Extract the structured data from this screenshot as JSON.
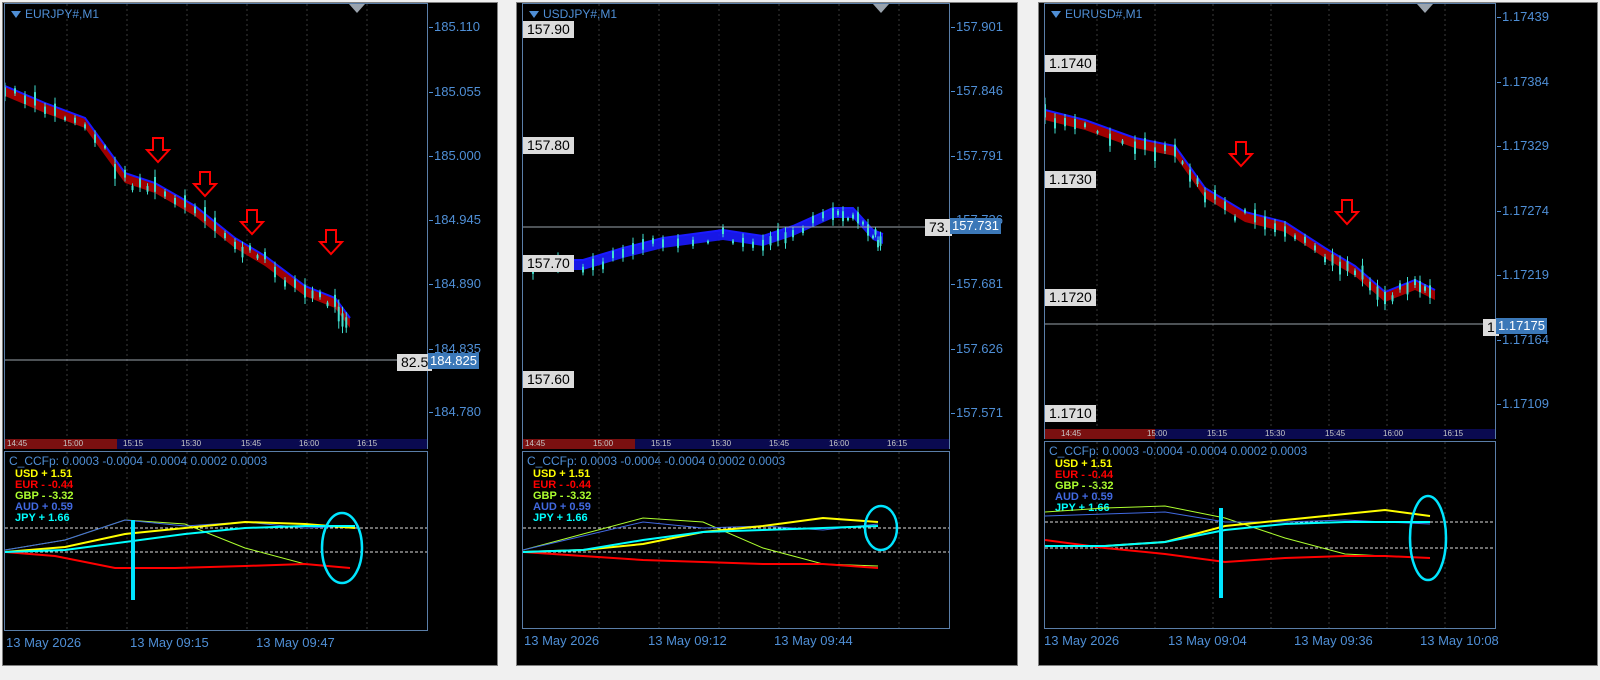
{
  "indicator_label": "C_CCFp: 0.0003 -0.0004 -0.0004 0.0002 0.0003",
  "legend": [
    {
      "ccy": "USD",
      "sign": "+",
      "val": "1.51",
      "color": "#ffff00"
    },
    {
      "ccy": "EUR",
      "sign": "-",
      "val": "-0.44",
      "color": "#ff0000"
    },
    {
      "ccy": "GBP",
      "sign": "-",
      "val": "-3.32",
      "color": "#adff2f"
    },
    {
      "ccy": "AUD",
      "sign": "+",
      "val": "0.59",
      "color": "#4169e1"
    },
    {
      "ccy": "JPY",
      "sign": "+",
      "val": "1.66",
      "color": "#00ffff"
    }
  ],
  "charts": [
    {
      "symbol": "EURJPY#,M1",
      "y_ticks": [
        "185.110",
        "185.055",
        "185.000",
        "184.945",
        "184.890",
        "184.835",
        "184.780"
      ],
      "current_price": "184.825",
      "cut_label": "82.5",
      "watermarks": [],
      "time_labels": [
        "14:45",
        "15:00",
        "15:15",
        "15:30",
        "15:45",
        "16:00",
        "16:15"
      ],
      "x_labels": [
        "13 May 2026",
        "13 May 09:15",
        "13 May 09:47"
      ],
      "arrows": 4
    },
    {
      "symbol": "USDJPY#,M1",
      "y_ticks": [
        "157.901",
        "157.846",
        "157.791",
        "157.736",
        "157.681",
        "157.626",
        "157.571"
      ],
      "current_price": "157.731",
      "cut_label": "73.",
      "watermarks": [
        "157.90",
        "157.80",
        "157.70",
        "157.60"
      ],
      "time_labels": [
        "14:45",
        "15:00",
        "15:15",
        "15:30",
        "15:45",
        "16:00",
        "16:15"
      ],
      "x_labels": [
        "13 May 2026",
        "13 May 09:12",
        "13 May 09:44"
      ],
      "arrows": 0
    },
    {
      "symbol": "EURUSD#,M1",
      "y_ticks": [
        "1.17439",
        "1.17384",
        "1.17329",
        "1.17274",
        "1.17219",
        "1.17164",
        "1.17109"
      ],
      "current_price": "1.17175",
      "cut_label": "1",
      "watermarks": [
        "1.1740",
        "1.1730",
        "1.1720",
        "1.1710"
      ],
      "time_labels": [
        "14:45",
        "15:00",
        "15:15",
        "15:30",
        "15:45",
        "16:00",
        "16:15"
      ],
      "x_labels": [
        "13 May 2026",
        "13 May 09:04",
        "13 May 09:36",
        "13 May 10:08"
      ],
      "arrows": 2
    }
  ],
  "colors": {
    "candle": "#40e0d0",
    "ribbon_red": "#b30000",
    "ribbon_blue": "#1a1aff",
    "arrow": "#ff0000",
    "axis": "#4f8fd6",
    "circle": "#00e5ff"
  }
}
